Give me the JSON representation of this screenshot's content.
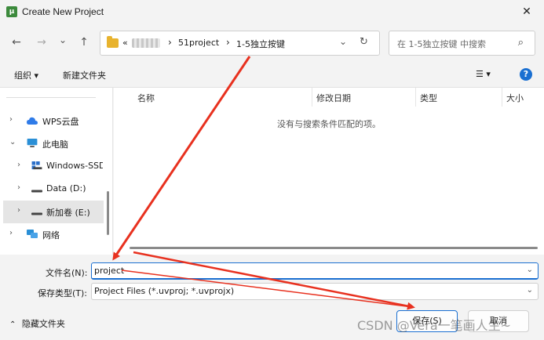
{
  "window": {
    "title": "Create New Project",
    "app_icon": "uvision-icon",
    "close_glyph": "✕"
  },
  "nav": {
    "back_glyph": "←",
    "forward_glyph": "→",
    "recent_glyph": "⌄",
    "up_glyph": "↑",
    "breadcrumb": {
      "prefix": "«",
      "items": [
        "51project",
        "1-5独立按键"
      ],
      "sep": "›",
      "end_chevron": "⌄",
      "refresh_glyph": "↻"
    },
    "search_placeholder": "在 1-5独立按键 中搜索",
    "search_glyph": "⌕"
  },
  "toolbar": {
    "organize": "组织 ▾",
    "new_folder": "新建文件夹",
    "view_glyph": "☰ ▾",
    "help_glyph": "?"
  },
  "sidebar": {
    "items": [
      {
        "label": "WPS云盘",
        "chevron": "›",
        "icon": "cloud-icon"
      },
      {
        "label": "此电脑",
        "chevron": "⌄",
        "icon": "computer-icon"
      },
      {
        "label": "Windows-SSD",
        "chevron": "›",
        "icon": "drive-icon"
      },
      {
        "label": "Data (D:)",
        "chevron": "›",
        "icon": "drive-icon"
      },
      {
        "label": "新加卷 (E:)",
        "chevron": "›",
        "icon": "drive-icon"
      },
      {
        "label": "网络",
        "chevron": "›",
        "icon": "network-icon"
      }
    ]
  },
  "files": {
    "columns": [
      "名称",
      "修改日期",
      "类型",
      "大小"
    ],
    "empty_message": "没有与搜索条件匹配的项。"
  },
  "form": {
    "filename_label": "文件名(N):",
    "filename_value": "project",
    "filetype_label": "保存类型(T):",
    "filetype_value": "Project Files (*.uvproj; *.uvprojx)"
  },
  "footer": {
    "hide_folders": "隐藏文件夹",
    "save_label": "保存(S)",
    "cancel_label": "取消"
  },
  "watermark": "CSDN @Vera一笔画人生~",
  "colors": {
    "accent": "#1a6fd1",
    "arrow": "#e8311f",
    "folder": "#e8b32e"
  }
}
